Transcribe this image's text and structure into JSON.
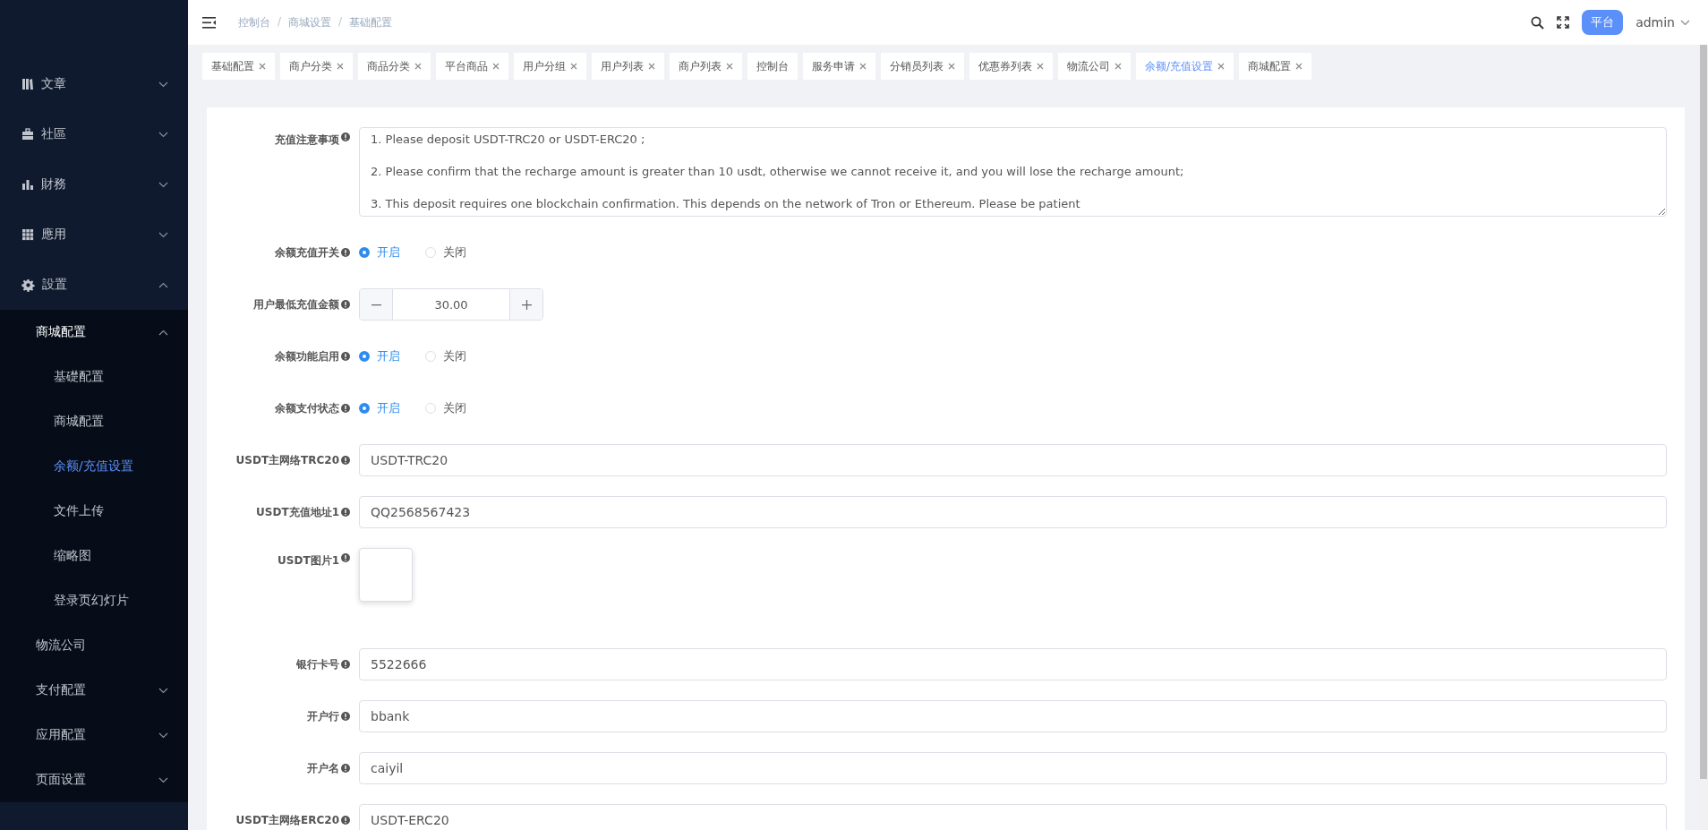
{
  "sidebar": {
    "items": [
      {
        "label": "文章",
        "expanded": false
      },
      {
        "label": "社區",
        "expanded": false
      },
      {
        "label": "財務",
        "expanded": false
      },
      {
        "label": "應用",
        "expanded": false
      },
      {
        "label": "設置",
        "expanded": true,
        "children": [
          {
            "label": "商城配置",
            "expanded": true,
            "children": [
              {
                "label": "基礎配置",
                "selected": false
              },
              {
                "label": "商城配置",
                "selected": false
              },
              {
                "label": "余额/充值设置",
                "selected": true
              },
              {
                "label": "文件上传",
                "selected": false
              },
              {
                "label": "缩略图",
                "selected": false
              },
              {
                "label": "登录页幻灯片",
                "selected": false
              }
            ]
          },
          {
            "label": "物流公司",
            "selected": false
          },
          {
            "label": "支付配置",
            "expanded": false
          },
          {
            "label": "应用配置",
            "expanded": false
          },
          {
            "label": "页面设置",
            "expanded": false
          }
        ]
      }
    ]
  },
  "breadcrumb": {
    "separator": "/",
    "items": [
      "控制台",
      "商城设置",
      "基础配置"
    ]
  },
  "header": {
    "badge": "平台",
    "user": "admin"
  },
  "tabs": [
    {
      "label": "基础配置",
      "selected": false,
      "closable": true
    },
    {
      "label": "商户分类",
      "selected": false,
      "closable": true
    },
    {
      "label": "商品分类",
      "selected": false,
      "closable": true
    },
    {
      "label": "平台商品",
      "selected": false,
      "closable": true
    },
    {
      "label": "用户分组",
      "selected": false,
      "closable": true
    },
    {
      "label": "用户列表",
      "selected": false,
      "closable": true
    },
    {
      "label": "商户列表",
      "selected": false,
      "closable": true
    },
    {
      "label": "控制台",
      "selected": false,
      "closable": false
    },
    {
      "label": "服务申请",
      "selected": false,
      "closable": true
    },
    {
      "label": "分销员列表",
      "selected": false,
      "closable": true
    },
    {
      "label": "优惠券列表",
      "selected": false,
      "closable": true
    },
    {
      "label": "物流公司",
      "selected": false,
      "closable": true
    },
    {
      "label": "余额/充值设置",
      "selected": true,
      "closable": true
    },
    {
      "label": "商城配置",
      "selected": false,
      "closable": true
    }
  ],
  "form": {
    "fields": [
      {
        "kind": "textarea",
        "label": "充值注意事项",
        "value": "1. Please deposit USDT-TRC20 or USDT-ERC20 ;\n\n2. Please confirm that the recharge amount is greater than 10 usdt, otherwise we cannot receive it, and you will lose the recharge amount;\n\n3. This deposit requires one blockchain confirmation. This depends on the network of Tron or Ethereum. Please be patient"
      },
      {
        "kind": "radio",
        "label": "余额充值开关",
        "options": [
          {
            "label": "开启",
            "selected": true
          },
          {
            "label": "关闭",
            "selected": false
          }
        ]
      },
      {
        "kind": "number",
        "label": "用户最低充值金额",
        "value": "30.00"
      },
      {
        "kind": "radio",
        "label": "余额功能启用",
        "options": [
          {
            "label": "开启",
            "selected": true
          },
          {
            "label": "关闭",
            "selected": false
          }
        ]
      },
      {
        "kind": "radio",
        "label": "余额支付状态",
        "options": [
          {
            "label": "开启",
            "selected": true
          },
          {
            "label": "关闭",
            "selected": false
          }
        ]
      },
      {
        "kind": "text",
        "label": "USDT主网络TRC20",
        "value": "USDT-TRC20"
      },
      {
        "kind": "text",
        "label": "USDT充值地址1",
        "value": "QQ2568567423"
      },
      {
        "kind": "upload",
        "label": "USDT图片1"
      },
      {
        "kind": "text",
        "label": "银行卡号",
        "value": "5522666"
      },
      {
        "kind": "text",
        "label": "开户行",
        "value": "bbank"
      },
      {
        "kind": "text",
        "label": "开户名",
        "value": "caiyil"
      },
      {
        "kind": "text",
        "label": "USDT主网络ERC20",
        "value": "USDT-ERC20"
      }
    ]
  }
}
